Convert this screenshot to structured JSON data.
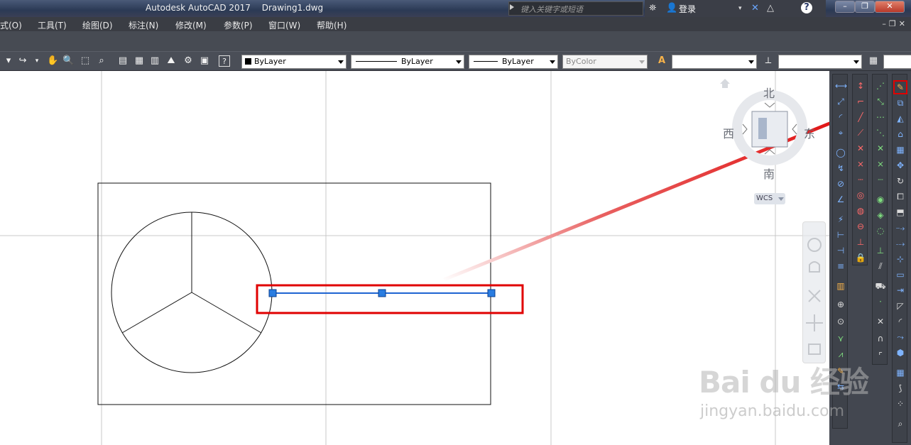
{
  "titlebar": {
    "app_title": "Autodesk AutoCAD 2017",
    "document": "Drawing1.dwg",
    "search_placeholder": "键入关键字或短语",
    "login": "登录",
    "help": "?"
  },
  "menubar": {
    "items": [
      "式(O)",
      "工具(T)",
      "绘图(D)",
      "标注(N)",
      "修改(M)",
      "参数(P)",
      "窗口(W)",
      "帮助(H)"
    ]
  },
  "properties_toolbar": {
    "color": "ByLayer",
    "linetype": "ByLayer",
    "lineweight": "ByLayer",
    "plotstyle": "ByColor",
    "textstyle": "",
    "dimstyle": ""
  },
  "viewcube": {
    "north": "北",
    "south": "南",
    "west": "西",
    "east": "东",
    "wcs": "WCS"
  },
  "watermark": {
    "brand": "Bai du 经验",
    "url": "jingyan.baidu.com"
  },
  "colors": {
    "annotation_red": "#e00000",
    "selection_blue": "#1e64d2",
    "grip_blue": "#2a7de1",
    "ui_dark": "#3e424a"
  },
  "icons": {
    "selected_tool": "line-pencil-icon"
  }
}
